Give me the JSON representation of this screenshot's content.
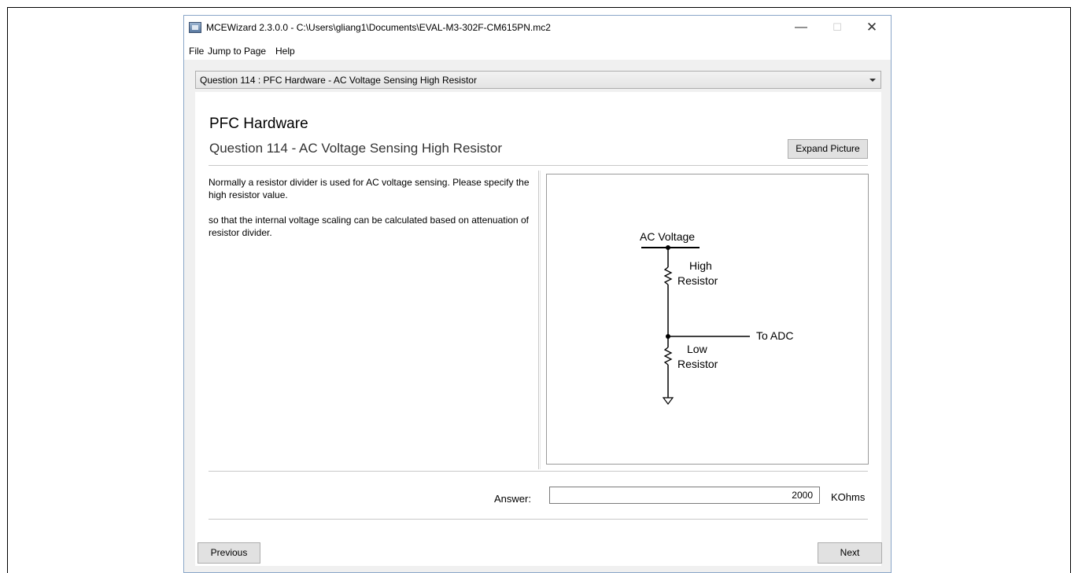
{
  "window": {
    "title": "MCEWizard 2.3.0.0  - C:\\Users\\gliang1\\Documents\\EVAL-M3-302F-CM615PN.mc2",
    "minimize_glyph": "—",
    "maximize_glyph": "☐",
    "close_glyph": "✕"
  },
  "menu": {
    "items": [
      "File",
      "Jump to Page",
      "Help"
    ]
  },
  "question_selector": {
    "selected": "Question  114 : PFC Hardware - AC Voltage Sensing High Resistor"
  },
  "page": {
    "section_title": "PFC Hardware",
    "question_title": "Question 114 - AC Voltage Sensing High Resistor",
    "expand_label": "Expand Picture",
    "description": [
      "Normally a resistor divider is used for AC voltage sensing. Please specify the high resistor value.",
      "so that the internal voltage scaling can be calculated based on attenuation of resistor divider."
    ]
  },
  "diagram": {
    "top_label": "AC Voltage",
    "high_resistor_label_1": "High",
    "high_resistor_label_2": "Resistor",
    "low_resistor_label_1": "Low",
    "low_resistor_label_2": "Resistor",
    "output_label": "To ADC"
  },
  "answer": {
    "label": "Answer:",
    "value": "2000",
    "unit": "KOhms"
  },
  "navigation": {
    "previous_label": "Previous",
    "next_label": "Next"
  },
  "colors": {
    "window_border": "#8aa6c8",
    "window_bg": "#f0f0f0",
    "button_bg": "#e1e1e1"
  }
}
